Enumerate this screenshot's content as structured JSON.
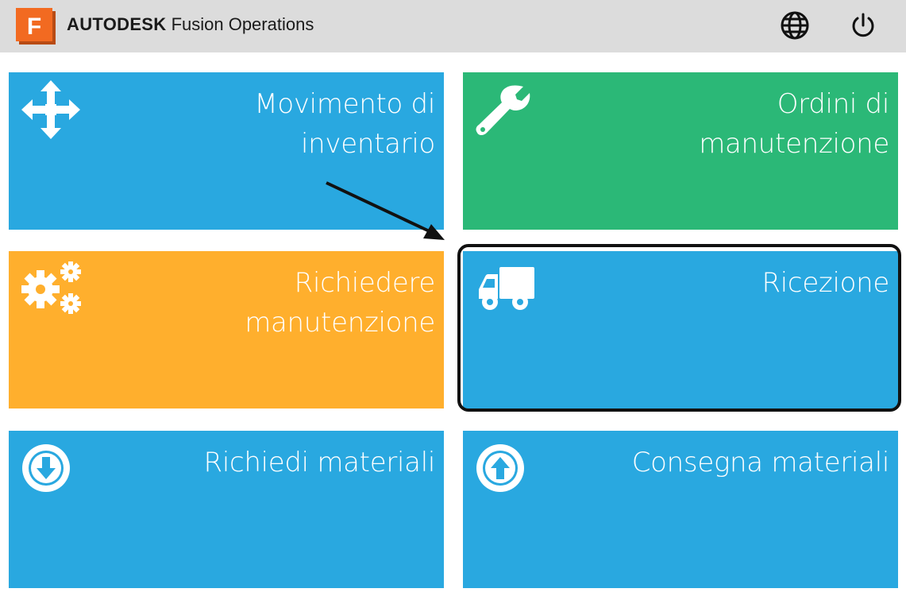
{
  "app": {
    "logo_letter": "F",
    "brand_bold": "AUTODESK",
    "brand_rest": " Fusion Operations"
  },
  "header": {
    "language_icon": "globe-icon",
    "power_icon": "power-icon"
  },
  "tiles": [
    {
      "label": "Movimento di\ninventario",
      "icon": "move-arrows-icon",
      "color": "#29a8e0"
    },
    {
      "label": "Ordini di\nmanutenzione",
      "icon": "wrench-icon",
      "color": "#2bb877"
    },
    {
      "label": "Richiedere\nmanutenzione",
      "icon": "gears-icon",
      "color": "#ffaf2d"
    },
    {
      "label": "Ricezione",
      "icon": "truck-icon",
      "color": "#29a8e0"
    },
    {
      "label": "Richiedi materiali",
      "icon": "arrow-down-circle-icon",
      "color": "#29a8e0"
    },
    {
      "label": "Consegna materiali",
      "icon": "arrow-up-circle-icon",
      "color": "#29a8e0"
    }
  ],
  "colors": {
    "header_bg": "#dcdcdc",
    "blue": "#29a8e0",
    "green": "#2bb877",
    "orange": "#ffaf2d",
    "logo": "#f26a21"
  }
}
